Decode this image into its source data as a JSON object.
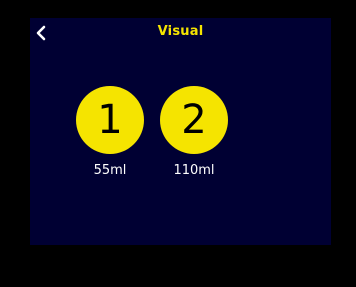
{
  "screen": {
    "title": "Visual",
    "back_icon": "chevron-left-icon",
    "colors": {
      "background": "#000033",
      "accent": "#f5e400",
      "label": "#ffffff"
    }
  },
  "options": [
    {
      "number": "1",
      "volume": "55ml"
    },
    {
      "number": "2",
      "volume": "110ml"
    }
  ]
}
